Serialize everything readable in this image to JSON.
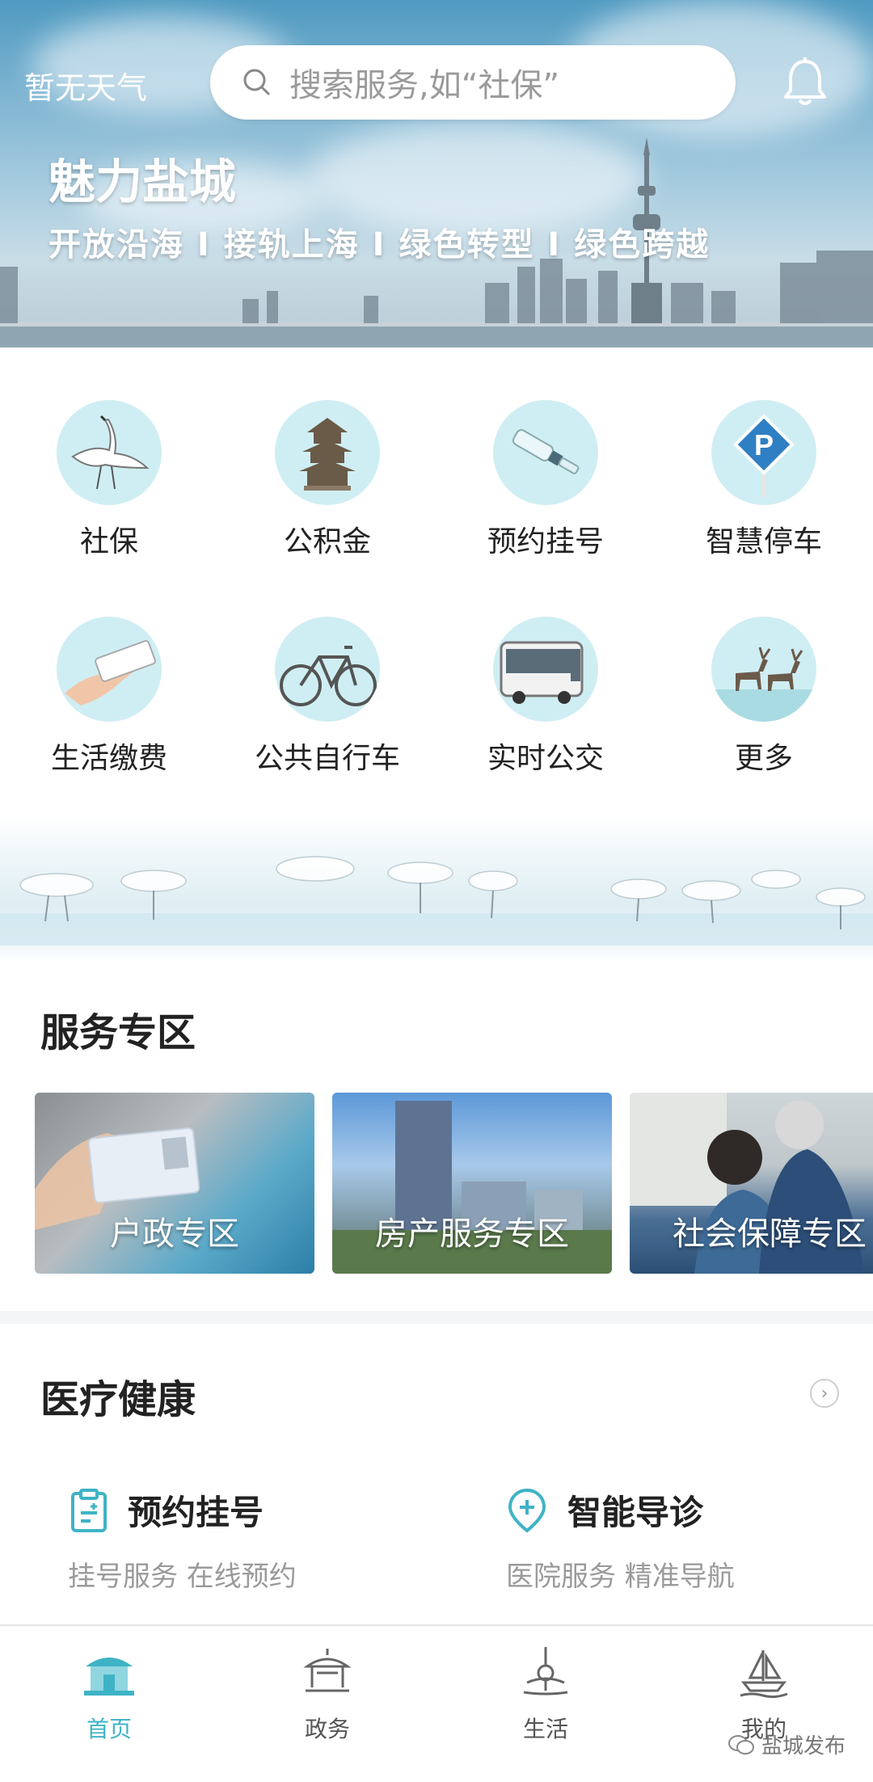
{
  "header": {
    "weather": "暂无天气",
    "search_placeholder": "搜索服务,如“社保”",
    "title": "魅力盐城",
    "subtitle": "开放沿海 I 接轨上海 I 绿色转型 I 绿色跨越"
  },
  "quick_services": [
    {
      "label": "社保",
      "icon": "crane-icon"
    },
    {
      "label": "公积金",
      "icon": "pagoda-icon"
    },
    {
      "label": "预约挂号",
      "icon": "medicine-vial-icon"
    },
    {
      "label": "智慧停车",
      "icon": "parking-sign-icon"
    },
    {
      "label": "生活缴费",
      "icon": "hand-payment-icon"
    },
    {
      "label": "公共自行车",
      "icon": "bicycle-icon"
    },
    {
      "label": "实时公交",
      "icon": "bus-icon"
    },
    {
      "label": "更多",
      "icon": "deer-icon"
    }
  ],
  "service_zone": {
    "title": "服务专区",
    "cards": [
      {
        "label": "户政专区"
      },
      {
        "label": "房产服务专区"
      },
      {
        "label": "社会保障专区"
      }
    ]
  },
  "medical": {
    "title": "医疗健康",
    "items": [
      {
        "title": "预约挂号",
        "subtitle": "挂号服务 在线预约",
        "icon": "clipboard-plus-icon"
      },
      {
        "title": "智能导诊",
        "subtitle": "医院服务 精准导航",
        "icon": "location-plus-icon"
      }
    ]
  },
  "tabs": [
    {
      "label": "首页",
      "icon": "home-temple-icon",
      "active": true
    },
    {
      "label": "政务",
      "icon": "government-hall-icon",
      "active": false
    },
    {
      "label": "生活",
      "icon": "tower-icon",
      "active": false
    },
    {
      "label": "我的",
      "icon": "sailboat-icon",
      "active": false
    }
  ],
  "watermark": "盐城发布",
  "colors": {
    "accent": "#3fb3c6",
    "icon_circle": "#cfeef3"
  }
}
